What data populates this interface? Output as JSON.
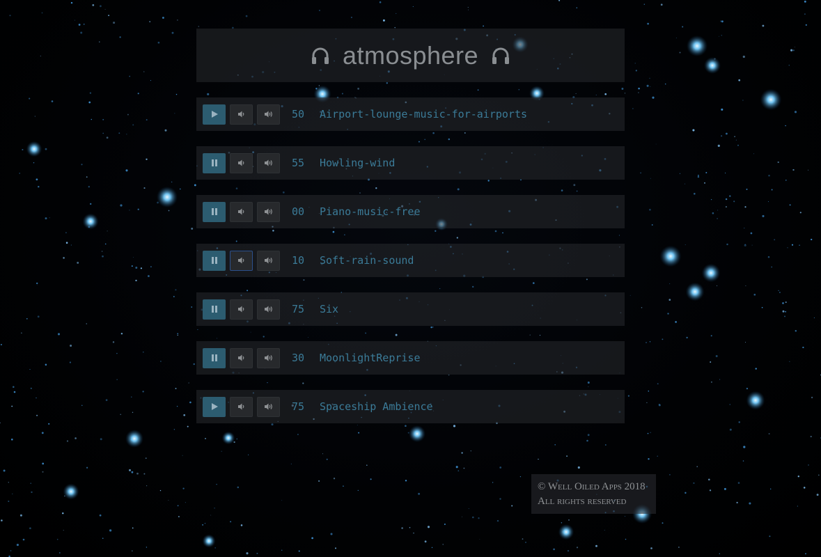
{
  "app": {
    "title": "atmosphere",
    "title_icon": "headphones-icon"
  },
  "colors": {
    "accent": "#3b7b98",
    "play_button": "#2c5c70",
    "panel": "#282a2e",
    "text_muted": "#8a8e92"
  },
  "tracks": [
    {
      "state": "paused",
      "button_icon": "play-icon",
      "volume": "50",
      "name": "Airport-lounge-music-for-airports"
    },
    {
      "state": "playing",
      "button_icon": "pause-icon",
      "volume": "55",
      "name": "Howling-wind"
    },
    {
      "state": "playing",
      "button_icon": "pause-icon",
      "volume": "00",
      "name": "Piano-music-free"
    },
    {
      "state": "playing",
      "button_icon": "pause-icon",
      "volume": "10",
      "name": "Soft-rain-sound"
    },
    {
      "state": "playing",
      "button_icon": "pause-icon",
      "volume": "75",
      "name": "Six"
    },
    {
      "state": "playing",
      "button_icon": "pause-icon",
      "volume": "30",
      "name": "MoonlightReprise"
    },
    {
      "state": "paused",
      "button_icon": "play-icon",
      "volume": "75",
      "name": "Spaceship Ambience"
    }
  ],
  "footer": {
    "copyright": "© Well Oiled Apps 2018",
    "rights": "All rights reserved"
  }
}
